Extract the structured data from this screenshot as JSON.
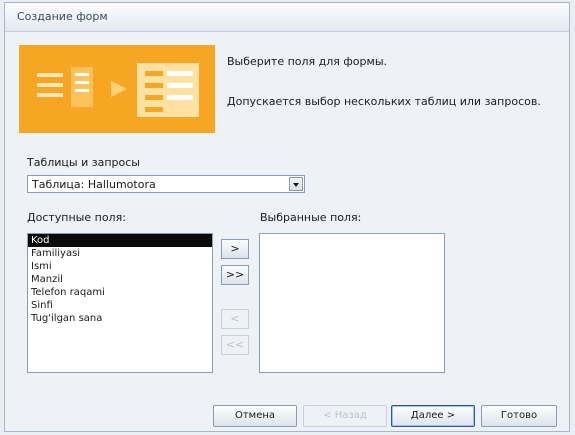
{
  "window": {
    "title": "Создание форм"
  },
  "instructions": {
    "line1": "Выберите поля для формы.",
    "line2": "Допускается выбор нескольких таблиц или запросов."
  },
  "tables_label": "Таблицы и запросы",
  "tables_combo": {
    "value": "Таблица: Hallumotora"
  },
  "available_label": "Доступные поля:",
  "selected_label": "Выбранные поля:",
  "available_fields": [
    "Kod",
    "Familiyasi",
    "Ismi",
    "Manzil",
    "Telefon raqami",
    "Sinfi",
    "Tug'ilgan sana"
  ],
  "selected_fields": [],
  "move_buttons": {
    "add_one": ">",
    "add_all": ">>",
    "remove_one": "<",
    "remove_all": "<<"
  },
  "buttons": {
    "cancel": "Отмена",
    "back": "< Назад",
    "next": "Далее >",
    "finish": "Готово"
  }
}
